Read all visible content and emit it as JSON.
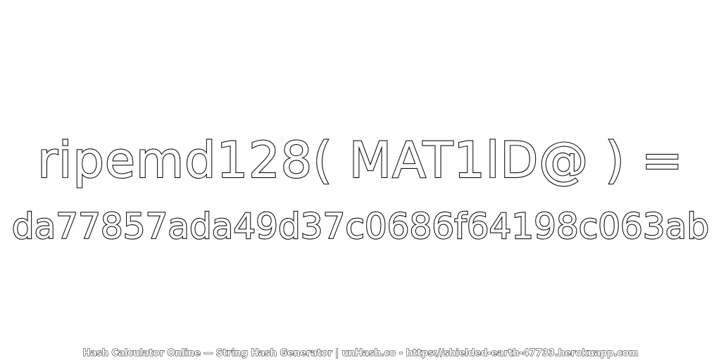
{
  "expression": "ripemd128( MAT1lD@ ) =",
  "digest": "da77857ada49d37c0686f64198c063ab",
  "footer": "Hash Calculator Online — String Hash Generator | unHash.co - https://shielded-earth-47733.herokuapp.com",
  "colors": {
    "background": "#ffffff",
    "text_fill": "#ffffff",
    "text_outline": "#111111"
  }
}
